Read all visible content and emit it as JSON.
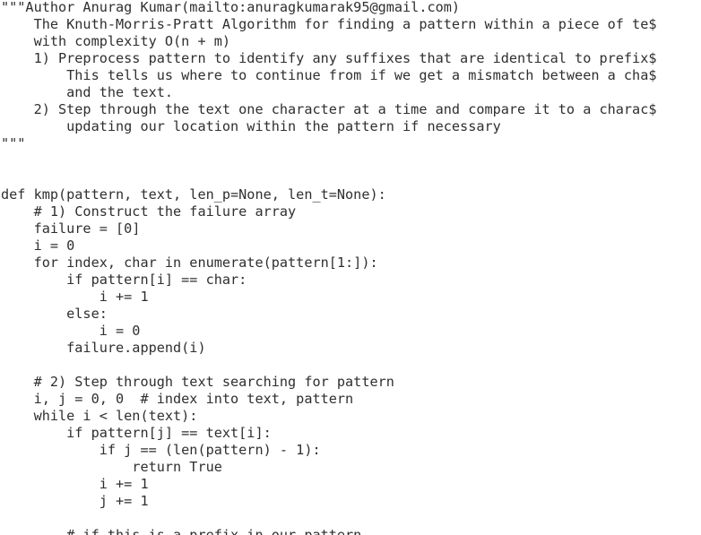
{
  "editor": {
    "lines": [
      "\"\"\"Author Anurag Kumar(mailto:anuragkumarak95@gmail.com)",
      "    The Knuth-Morris-Pratt Algorithm for finding a pattern within a piece of te$",
      "    with complexity O(n + m)",
      "    1) Preprocess pattern to identify any suffixes that are identical to prefix$",
      "        This tells us where to continue from if we get a mismatch between a cha$",
      "        and the text.",
      "    2) Step through the text one character at a time and compare it to a charac$",
      "        updating our location within the pattern if necessary",
      "\"\"\"",
      "",
      "",
      "def kmp(pattern, text, len_p=None, len_t=None):",
      "    # 1) Construct the failure array",
      "    failure = [0]",
      "    i = 0",
      "    for index, char in enumerate(pattern[1:]):",
      "        if pattern[i] == char:",
      "            i += 1",
      "        else:",
      "            i = 0",
      "        failure.append(i)",
      "",
      "    # 2) Step through text searching for pattern",
      "    i, j = 0, 0  # index into text, pattern",
      "    while i < len(text):",
      "        if pattern[j] == text[i]:",
      "            if j == (len(pattern) - 1):",
      "                return True",
      "            i += 1",
      "            j += 1",
      "",
      "        # if this is a prefix in our pattern"
    ]
  }
}
